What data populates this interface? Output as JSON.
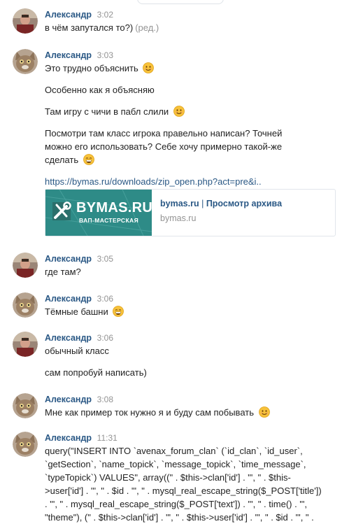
{
  "messages": [
    {
      "author": "Александр",
      "time": "3:02",
      "avatar": "person-photo",
      "lines": [
        "в чём запутался то?)"
      ],
      "edited": "(ред.)"
    },
    {
      "author": "Александр",
      "time": "3:03",
      "avatar": "cat-photo",
      "lines": [
        "Это трудно объяснить",
        "Особенно как я объясняю",
        "Там игру с чичи в пабл слили",
        "Посмотри там класс игрока правельно написан? Точней",
        "можно его использовать? Себе хочу примерно такой-же",
        "сделать"
      ],
      "link": "https://bymas.ru/downloads/zip_open.php?act=pre&i..",
      "attachment": {
        "logo_text": "BYMAS.RU",
        "logo_subtext": "ВАП-МАСТЕРСКАЯ",
        "title_site": "bymas.ru",
        "title_sep": "|",
        "title_action": "Просмотр архива",
        "domain": "bymas.ru"
      }
    },
    {
      "author": "Александр",
      "time": "3:05",
      "avatar": "person-photo",
      "lines": [
        "где там?"
      ]
    },
    {
      "author": "Александр",
      "time": "3:06",
      "avatar": "cat-photo",
      "lines": [
        "Тёмные башни"
      ]
    },
    {
      "author": "Александр",
      "time": "3:06",
      "avatar": "person-photo",
      "lines": [
        "обычный класс",
        "сам попробуй написать)"
      ]
    },
    {
      "author": "Александр",
      "time": "3:08",
      "avatar": "cat-photo",
      "lines": [
        "Мне как пример ток нужно я и буду сам побывать"
      ]
    },
    {
      "author": "Александр",
      "time": "11:31",
      "avatar": "cat-photo",
      "code": [
        "query(\"INSERT INTO `avenax_forum_clan` (`id_clan`, `id_user`,",
        "`getSection`, `name_topick`, `message_topick`, `time_message`,",
        "`typeTopick`) VALUES\", array((\" . $this->clan['id'] . \"', \" . $this-",
        ">user['id'] . \"', \" . $id . \"', \" . mysql_real_escape_string($_POST['title'])",
        ". \"', \" . mysql_real_escape_string($_POST['text']) . \"', \" . time() . \"',",
        "\"theme\"), (\" . $this->clan['id'] . \"', \" . $this->user['id'] . \"', \" . $id . \"', \" ."
      ]
    }
  ],
  "colors": {
    "author": "#2a5885",
    "time": "#939393",
    "link": "#2a5885",
    "card_bg": "#2b8a86"
  }
}
